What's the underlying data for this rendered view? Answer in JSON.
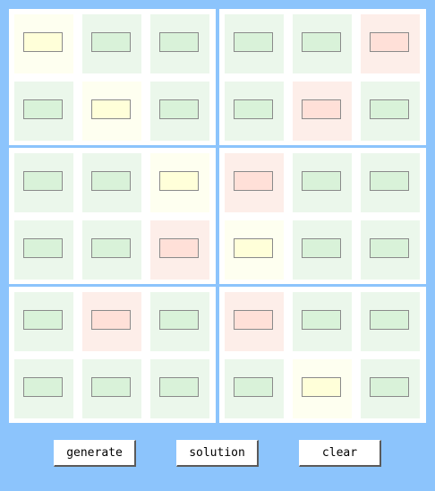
{
  "board": {
    "blocks": [
      [
        "yellow",
        "green",
        "green",
        "green",
        "yellow",
        "green"
      ],
      [
        "green",
        "green",
        "red",
        "green",
        "red",
        "green"
      ],
      [
        "green",
        "green",
        "yellow",
        "green",
        "green",
        "red"
      ],
      [
        "red",
        "green",
        "green",
        "yellow",
        "green",
        "green"
      ],
      [
        "green",
        "red",
        "green",
        "green",
        "green",
        "green"
      ],
      [
        "red",
        "green",
        "green",
        "green",
        "yellow",
        "green"
      ]
    ]
  },
  "buttons": {
    "generate": "generate",
    "solution": "solution",
    "clear": "clear"
  },
  "colors": {
    "background": "#8cc4fc",
    "green": "#ebf7eb",
    "yellow": "#fefff0",
    "red": "#fdeee9"
  }
}
